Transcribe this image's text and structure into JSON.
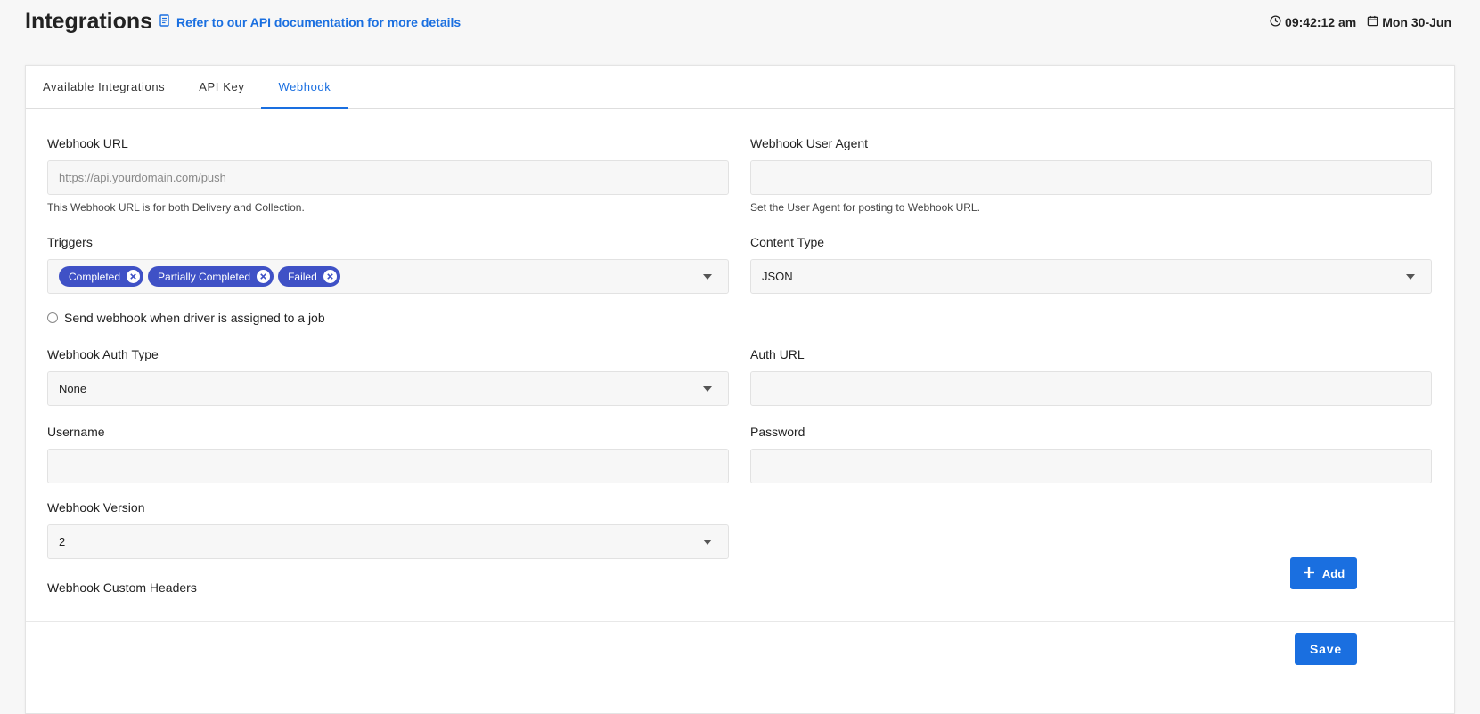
{
  "header": {
    "title": "Integrations",
    "doc_link": "Refer to our API documentation for more details",
    "time": "09:42:12 am",
    "date": "Mon 30-Jun"
  },
  "tabs": [
    {
      "label": "Available Integrations",
      "active": false
    },
    {
      "label": "API Key",
      "active": false
    },
    {
      "label": "Webhook",
      "active": true
    }
  ],
  "form": {
    "webhook_url": {
      "label": "Webhook URL",
      "placeholder": "https://api.yourdomain.com/push",
      "value": "",
      "helper": "This Webhook URL is for both Delivery and Collection."
    },
    "user_agent": {
      "label": "Webhook User Agent",
      "value": "",
      "helper": "Set the User Agent for posting to Webhook URL."
    },
    "triggers": {
      "label": "Triggers",
      "chips": [
        "Completed",
        "Partially Completed",
        "Failed"
      ]
    },
    "content_type": {
      "label": "Content Type",
      "value": "JSON"
    },
    "driver_checkbox": {
      "label": "Send webhook when driver is assigned to a job",
      "checked": false
    },
    "auth_type": {
      "label": "Webhook Auth Type",
      "value": "None"
    },
    "auth_url": {
      "label": "Auth URL",
      "value": ""
    },
    "username": {
      "label": "Username",
      "value": ""
    },
    "password": {
      "label": "Password",
      "value": ""
    },
    "version": {
      "label": "Webhook Version",
      "value": "2"
    },
    "custom_headers": {
      "label": "Webhook Custom Headers",
      "add_label": "Add"
    }
  },
  "footer": {
    "save_label": "Save"
  },
  "colors": {
    "accent": "#1a6fe0",
    "chip": "#3f51c6"
  }
}
